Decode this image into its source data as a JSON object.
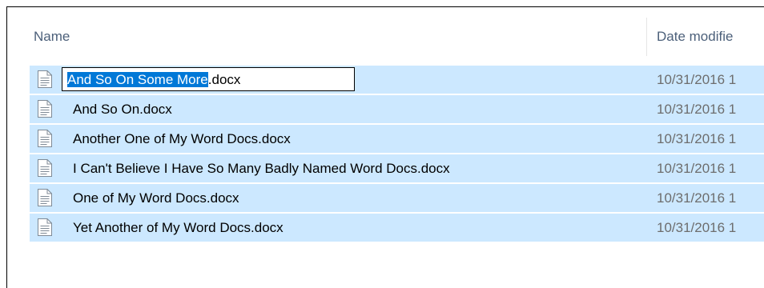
{
  "header": {
    "name_col": "Name",
    "date_col": "Date modifie"
  },
  "rename": {
    "selected_text": "And So On Some More",
    "extension": ".docx"
  },
  "files": [
    {
      "name": "And So On Some More.docx",
      "date": "10/31/2016 1",
      "editing": true
    },
    {
      "name": "And So On.docx",
      "date": "10/31/2016 1",
      "editing": false
    },
    {
      "name": "Another One of My Word Docs.docx",
      "date": "10/31/2016 1",
      "editing": false
    },
    {
      "name": "I Can't Believe I Have So Many Badly Named Word Docs.docx",
      "date": "10/31/2016 1",
      "editing": false
    },
    {
      "name": "One of My Word Docs.docx",
      "date": "10/31/2016 1",
      "editing": false
    },
    {
      "name": "Yet Another of My Word Docs.docx",
      "date": "10/31/2016 1",
      "editing": false
    }
  ],
  "colors": {
    "selection_bg": "#cce8ff",
    "text_selection": "#0078d7",
    "header_text": "#4c607a",
    "date_text": "#6d6d6d"
  },
  "icons": {
    "file": "document-icon"
  }
}
